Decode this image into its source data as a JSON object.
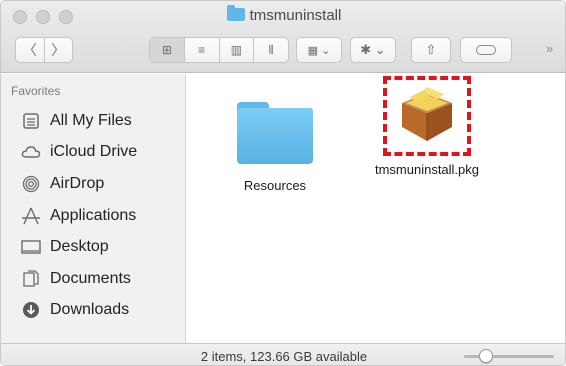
{
  "window": {
    "title": "tmsmuninstall"
  },
  "toolbar": {
    "back_glyph": "〈",
    "forward_glyph": "〉",
    "view_icons": [
      "⊞",
      "≡",
      "▥",
      "⫴"
    ],
    "arrange_glyph": "▦ ⌄",
    "action_glyph": "✱ ⌄",
    "share_glyph": "⇧",
    "more_glyph": "»"
  },
  "sidebar": {
    "heading": "Favorites",
    "items": [
      {
        "label": "All My Files",
        "icon": "all-files-icon"
      },
      {
        "label": "iCloud Drive",
        "icon": "cloud-icon"
      },
      {
        "label": "AirDrop",
        "icon": "airdrop-icon"
      },
      {
        "label": "Applications",
        "icon": "applications-icon"
      },
      {
        "label": "Desktop",
        "icon": "desktop-icon"
      },
      {
        "label": "Documents",
        "icon": "documents-icon"
      },
      {
        "label": "Downloads",
        "icon": "downloads-icon"
      }
    ]
  },
  "files": [
    {
      "name": "Resources",
      "kind": "folder"
    },
    {
      "name": "tmsmuninstall.pkg",
      "kind": "package"
    }
  ],
  "status": {
    "text": "2 items, 123.66 GB available",
    "zoom_level": 0.2
  },
  "colors": {
    "folder": "#5fb8ea",
    "highlight": "#e0141d"
  }
}
